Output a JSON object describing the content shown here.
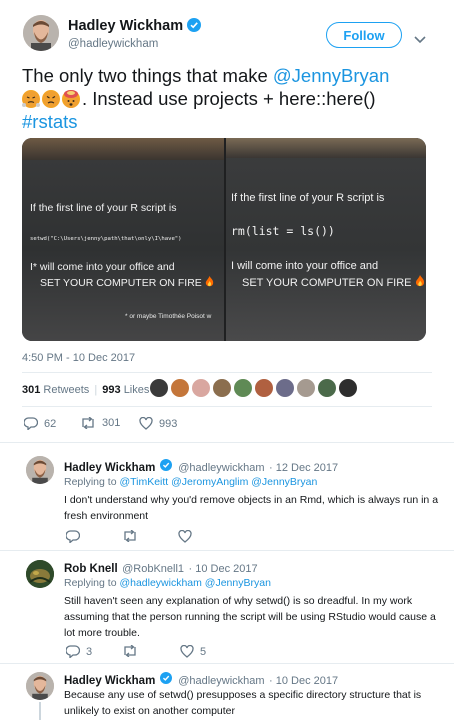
{
  "main_tweet": {
    "name": "Hadley Wickham",
    "handle": "@hadleywickham",
    "follow_label": "Follow",
    "text_part1": "The only two things that make ",
    "mention": "@JennyBryan",
    "text_part2": ". Instead use projects + here::here()",
    "hashtag": "#rstats",
    "emoji": [
      "angry-face-with-steam",
      "angry-face",
      "exploding-head"
    ],
    "timestamp": "4:50 PM - 10 Dec 2017",
    "retweets_count": "301",
    "retweets_label": "Retweets",
    "likes_count": "993",
    "likes_label": "Likes",
    "actions": {
      "replies": "62",
      "retweets": "301",
      "likes": "993"
    }
  },
  "slide_left": {
    "line1": "If the first line of your R script is",
    "code": "setwd(\"C:\\Users\\jenny\\path\\that\\only\\I\\have\")",
    "line2": "I* will come into your office and",
    "line3": "SET YOUR COMPUTER ON FIRE",
    "footnote": "* or maybe Timothée Poisot w"
  },
  "slide_right": {
    "line1": "If the first line of your R script is",
    "code": "rm(list = ls())",
    "line2": "I will come into your office and",
    "line3": "SET YOUR COMPUTER ON FIRE"
  },
  "replies": [
    {
      "name": "Hadley Wickham",
      "handle": "@hadleywickham",
      "date": "· 12 Dec 2017",
      "replying_label": "Replying to",
      "replying_to": "@TimKeitt @JeromyAnglim @JennyBryan",
      "text": "I don't understand why you'd remove objects in an Rmd, which is always run in a fresh environment",
      "replies": "",
      "retweets": "",
      "likes": ""
    },
    {
      "name": "Rob Knell",
      "handle": "@RobKnell1",
      "date": "· 10 Dec 2017",
      "replying_label": "Replying to",
      "replying_to": "@hadleywickham @JennyBryan",
      "text": "Still haven't seen any explanation of why setwd() is so dreadful. In my work assuming that the person running the script will be using RStudio would cause a lot more trouble.",
      "replies": "3",
      "retweets": "",
      "likes": "5"
    },
    {
      "name": "Hadley Wickham",
      "handle": "@hadleywickham",
      "date": "· 10 Dec 2017",
      "replying_label": "Replying to",
      "replying_to": "@JennyBryan",
      "text": "Because any use of setwd() presupposes a specific directory structure that is unlikely to exist on another computer"
    }
  ],
  "colors": {
    "accent": "#1da1f2",
    "link": "#1b95e0",
    "muted": "#657786",
    "fire": "#ff6a00"
  }
}
